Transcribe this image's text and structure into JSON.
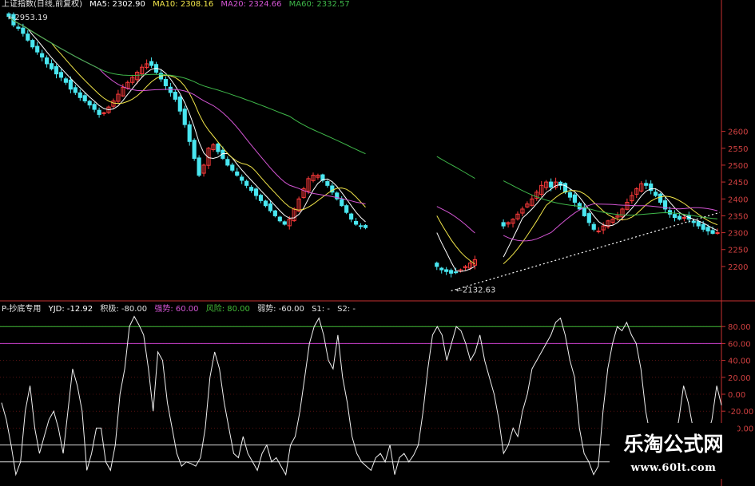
{
  "upper_header": {
    "index_name": "上证指数(日线,前复权)",
    "ma5": "MA5: 2302.90",
    "ma10": "MA10: 2308.16",
    "ma20": "MA20: 2324.66",
    "ma60": "MA60: 2332.57"
  },
  "lower_header": {
    "indicator_name": "P-抄底专用",
    "yjd": "YJD: -12.92",
    "jiji": "积极: -80.00",
    "qiangshi": "强势: 60.00",
    "fengxian": "风险: 80.00",
    "ruoshi": "弱势: -60.00",
    "s1": "S1: -",
    "s2": "S2: -"
  },
  "watermark": {
    "title": "乐淘公式网",
    "url": "www.60lt.com"
  },
  "colors": {
    "up": "#ff3b3b",
    "down": "#49e6f0",
    "ma5": "#ffffff",
    "ma10": "#f2e64a",
    "ma20": "#d455d4",
    "ma60": "#3fb84a",
    "risk_line": "#43ba38",
    "strong_line": "#c43ec8",
    "weak_line": "#d8d8d8",
    "axis": "#c83030",
    "grid": "#8a1c1c"
  },
  "chart_data": [
    {
      "type": "candlestick",
      "title": "上证指数(日线,前复权)",
      "y_ticks": [
        2200,
        2250,
        2300,
        2350,
        2400,
        2450,
        2500,
        2550,
        2600
      ],
      "ylim": [
        2110,
        2970
      ],
      "annotations": [
        {
          "label": "2953.19",
          "value": 2953.19,
          "kind": "high"
        },
        {
          "label": "2132.63",
          "value": 2132.63,
          "kind": "low"
        }
      ],
      "trendline": "dotted support line from the 2132.63 low rising to the right",
      "series_names": [
        "MA5",
        "MA10",
        "MA20",
        "MA60"
      ],
      "closes": [
        2940,
        2915,
        2905,
        2890,
        2870,
        2850,
        2835,
        2820,
        2800,
        2785,
        2770,
        2760,
        2745,
        2725,
        2715,
        2700,
        2690,
        2678,
        2665,
        2650,
        2655,
        2672,
        2690,
        2710,
        2730,
        2745,
        2760,
        2775,
        2790,
        2800,
        2795,
        2775,
        2755,
        2735,
        2715,
        2695,
        2660,
        2620,
        2570,
        2520,
        2470,
        2500,
        2550,
        2560,
        2540,
        2520,
        2500,
        2485,
        2470,
        2455,
        2440,
        2425,
        2410,
        2395,
        2380,
        2365,
        2350,
        2335,
        2325,
        2340,
        2370,
        2400,
        2430,
        2460,
        2470,
        2470,
        2455,
        2440,
        2420,
        2400,
        2380,
        2360,
        2340,
        2325,
        2320,
        2315,
        null,
        null,
        null,
        null,
        null,
        null,
        null,
        null,
        null,
        null,
        null,
        null,
        null,
        null,
        2200,
        2190,
        2185,
        2180,
        2182,
        2190,
        2200,
        2210,
        2220,
        null,
        null,
        null,
        null,
        null,
        2320,
        2330,
        2340,
        2355,
        2370,
        2385,
        2400,
        2420,
        2440,
        2450,
        2435,
        2450,
        2440,
        2420,
        2405,
        2390,
        2370,
        2350,
        2330,
        2310,
        2305,
        2320,
        2335,
        2340,
        2350,
        2370,
        2390,
        2410,
        2430,
        2445,
        2440,
        2425,
        2410,
        2390,
        2370,
        2355,
        2345,
        2340,
        2345,
        2340,
        2330,
        2320,
        2310,
        2305,
        2298,
        2300
      ]
    },
    {
      "type": "line",
      "title": "P-抄底专用",
      "y_ticks": [
        -40,
        -20,
        0,
        20,
        40,
        60,
        80
      ],
      "ylim": [
        -100,
        100
      ],
      "reference_lines": [
        {
          "name": "风险",
          "value": 80
        },
        {
          "name": "强势",
          "value": 60
        },
        {
          "name": "弱势",
          "value": -60
        },
        {
          "name": "积极",
          "value": -80
        }
      ],
      "series_name": "YJD",
      "values": [
        -10,
        -30,
        -60,
        -95,
        -80,
        -20,
        10,
        -40,
        -70,
        -50,
        -30,
        -20,
        -40,
        -70,
        -20,
        30,
        10,
        -20,
        -90,
        -70,
        -40,
        -40,
        -80,
        -90,
        -60,
        0,
        30,
        80,
        92,
        82,
        70,
        30,
        -20,
        50,
        40,
        -10,
        -40,
        -70,
        -85,
        -80,
        -82,
        -85,
        -75,
        -40,
        20,
        50,
        30,
        -10,
        -40,
        -70,
        -75,
        -50,
        -70,
        -80,
        -90,
        -70,
        -60,
        -80,
        -75,
        -85,
        -95,
        -60,
        -50,
        -20,
        20,
        60,
        80,
        90,
        70,
        40,
        30,
        70,
        20,
        -10,
        -50,
        -70,
        -80,
        -85,
        -90,
        -75,
        -70,
        -80,
        -60,
        -95,
        -75,
        -70,
        -80,
        -72,
        -60,
        -20,
        30,
        70,
        80,
        70,
        40,
        60,
        80,
        75,
        60,
        40,
        50,
        70,
        40,
        20,
        0,
        -30,
        -70,
        -60,
        -40,
        -50,
        -20,
        0,
        30,
        40,
        50,
        60,
        70,
        85,
        90,
        70,
        40,
        20,
        -40,
        -70,
        -80,
        -95,
        -85,
        -20,
        30,
        60,
        80,
        75,
        85,
        70,
        60,
        30,
        -20,
        -50,
        -70,
        -85,
        -95,
        -80,
        -60,
        -30,
        10,
        -10,
        -40,
        -60,
        -80,
        -50,
        -30,
        10,
        -13
      ]
    }
  ]
}
